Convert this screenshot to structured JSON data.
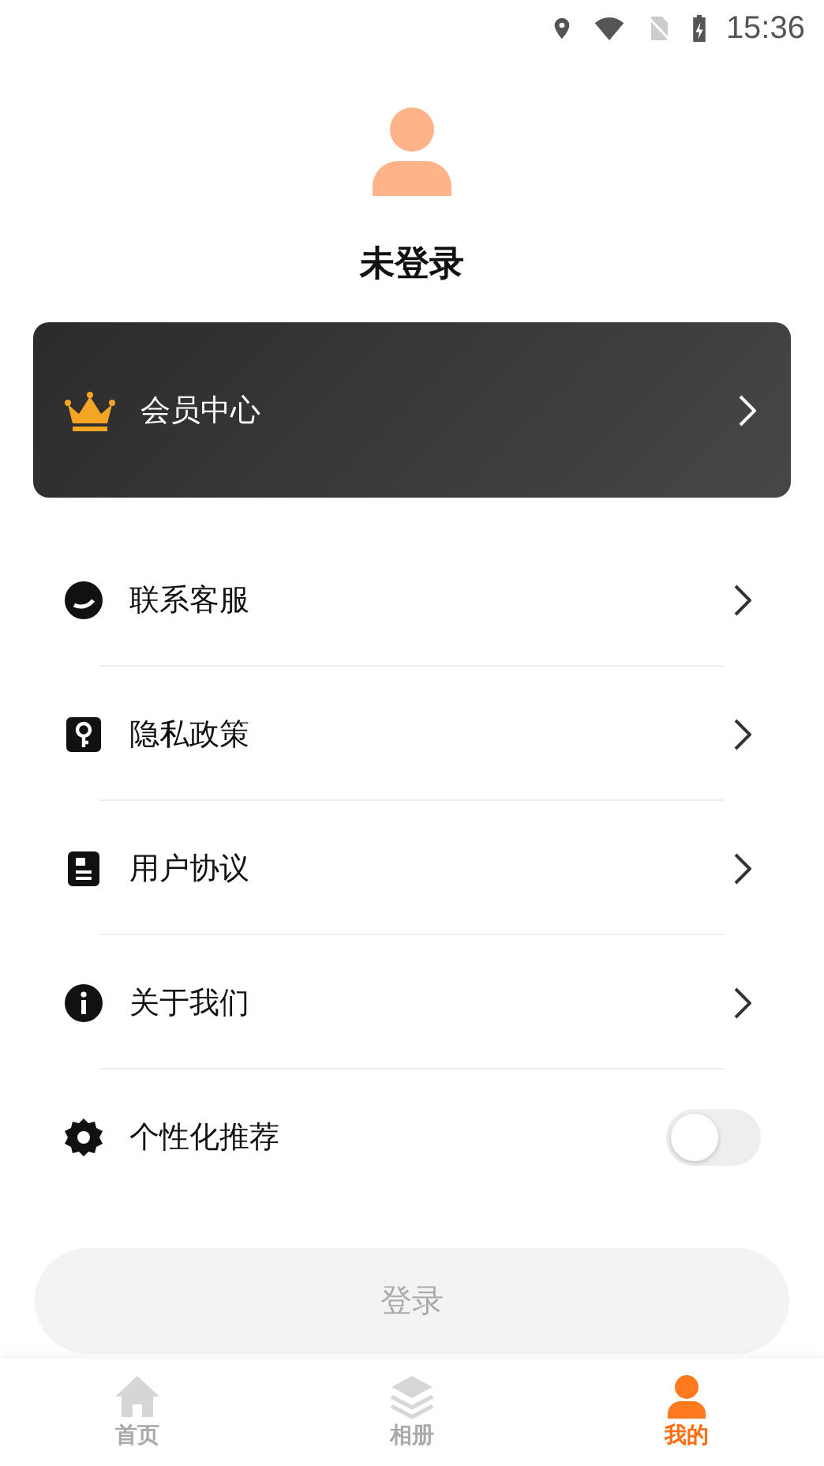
{
  "status_bar": {
    "time": "15:36"
  },
  "profile": {
    "name": "未登录"
  },
  "vip_card": {
    "label": "会员中心"
  },
  "menu": [
    {
      "kind": "link",
      "label": "联系客服"
    },
    {
      "kind": "link",
      "label": "隐私政策"
    },
    {
      "kind": "link",
      "label": "用户协议"
    },
    {
      "kind": "link",
      "label": "关于我们"
    },
    {
      "kind": "toggle",
      "label": "个性化推荐",
      "on": false
    }
  ],
  "login_button": {
    "label": "登录",
    "disabled": true
  },
  "tab_bar": [
    {
      "label": "首页",
      "selected": false
    },
    {
      "label": "相册",
      "selected": false
    },
    {
      "label": "我的",
      "selected": true
    }
  ]
}
